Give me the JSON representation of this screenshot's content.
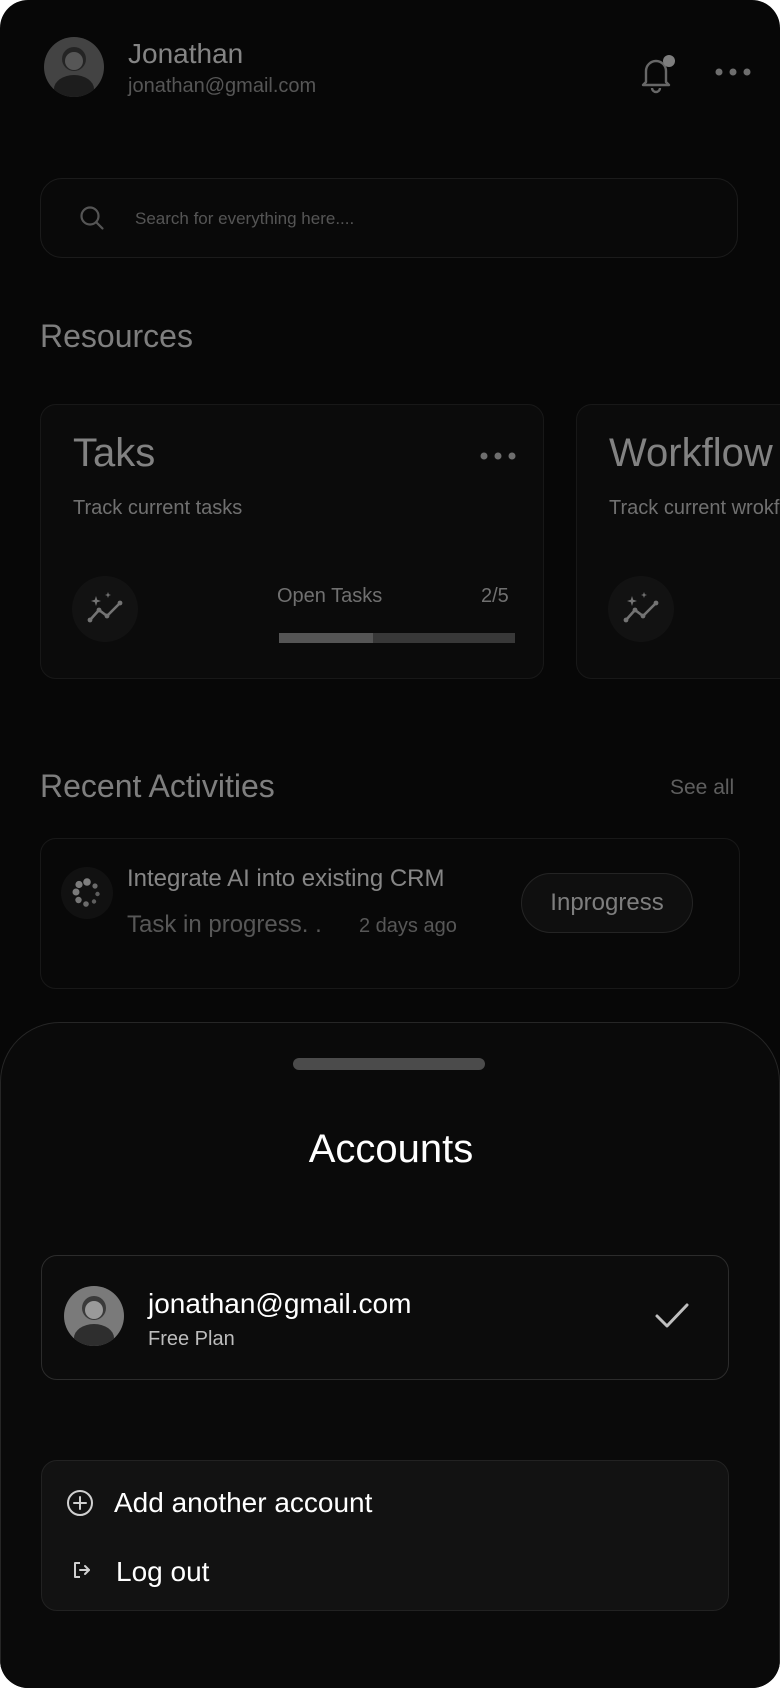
{
  "header": {
    "name": "Jonathan",
    "email": "jonathan@gmail.com",
    "notification_icon": "bell-icon",
    "menu_icon": "more-horizontal-icon"
  },
  "search": {
    "placeholder": "Search for everything here....",
    "icon": "search-icon"
  },
  "resources": {
    "title": "Resources",
    "cards": [
      {
        "title": "Taks",
        "subtitle": "Track current tasks",
        "icon": "sparkle-chart-icon",
        "progress_label": "Open Tasks",
        "progress_value": "2/5",
        "progress_fraction": 0.4
      },
      {
        "title": "Workflow",
        "subtitle": "Track current wrokflow",
        "icon": "sparkle-chart-icon"
      }
    ]
  },
  "activities": {
    "title": "Recent Activities",
    "see_all": "See all",
    "items": [
      {
        "title": "Integrate AI into existing CRM",
        "status_text": "Task in progress. .",
        "time": "2 days ago",
        "badge": "Inprogress",
        "icon": "loader-icon"
      }
    ]
  },
  "sheet": {
    "title": "Accounts",
    "account": {
      "email": "jonathan@gmail.com",
      "plan": "Free Plan",
      "check_icon": "check-icon"
    },
    "options": [
      {
        "label": "Add another account",
        "icon": "plus-circle-icon"
      },
      {
        "label": "Log out",
        "icon": "logout-icon"
      }
    ]
  },
  "colors": {
    "background": "#070707",
    "sheet": "#0a0a0a",
    "progress_fill": "#8a8a8a",
    "progress_track": "#5a5a5a"
  }
}
